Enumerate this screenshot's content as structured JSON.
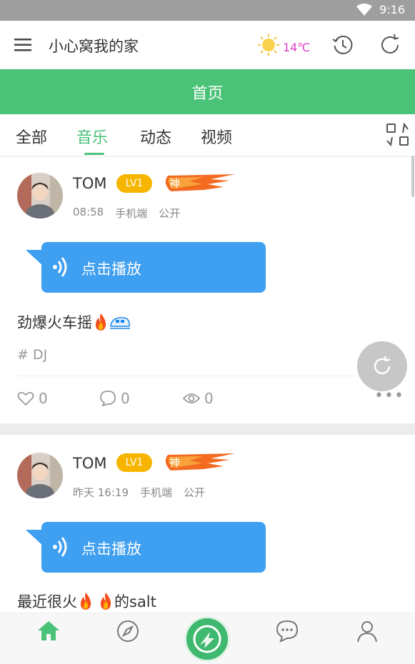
{
  "status_bar": {
    "time": "9:16"
  },
  "app_bar": {
    "title": "小心窝我的家",
    "temperature": "14℃",
    "menu_icon": "hamburger-menu-icon",
    "history_icon": "history-clock-icon",
    "refresh_icon": "refresh-icon"
  },
  "header": {
    "title": "首页"
  },
  "tabs": [
    {
      "label": "全部",
      "active": false
    },
    {
      "label": "音乐",
      "active": true
    },
    {
      "label": "动态",
      "active": false
    },
    {
      "label": "视频",
      "active": false
    }
  ],
  "posts": [
    {
      "username": "TOM",
      "level": "LV1",
      "badge": "神",
      "time": "08:58",
      "device": "手机端",
      "visibility": "公开",
      "play_label": "点击播放",
      "text": "劲爆火车摇",
      "tag": "# DJ",
      "likes": "0",
      "comments": "0",
      "views": "0"
    },
    {
      "username": "TOM",
      "level": "LV1",
      "badge": "神",
      "time": "昨天 16:19",
      "device": "手机端",
      "visibility": "公开",
      "play_label": "点击播放",
      "text_before": "最近很火",
      "text_after": "的salt"
    }
  ],
  "colors": {
    "accent_green": "#4ac277",
    "bubble_blue": "#3f9ff0",
    "level_yellow": "#f7b500",
    "temperature_magenta": "#e040c8"
  },
  "bottom_nav": [
    "home-icon",
    "compass-icon",
    "center-action-icon",
    "chat-icon",
    "profile-icon"
  ]
}
